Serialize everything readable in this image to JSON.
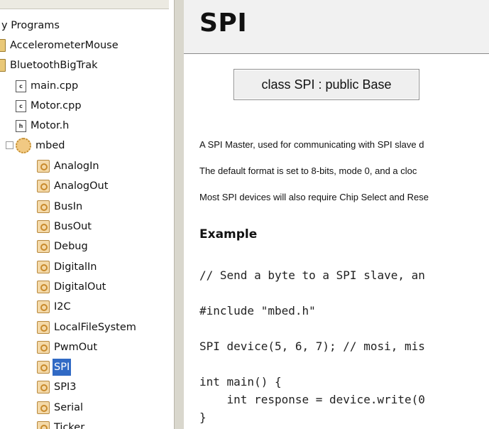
{
  "tree": {
    "items": [
      {
        "label": "y Programs",
        "icon": "none"
      },
      {
        "label": "AccelerometerMouse",
        "icon": "folder"
      },
      {
        "label": "BluetoothBigTrak",
        "icon": "folder"
      },
      {
        "label": "main.cpp",
        "icon": "cpp-file",
        "badge": "c"
      },
      {
        "label": "Motor.cpp",
        "icon": "cpp-file",
        "badge": "c"
      },
      {
        "label": "Motor.h",
        "icon": "header-file",
        "badge": "h"
      },
      {
        "label": "mbed",
        "icon": "gear"
      },
      {
        "label": "AnalogIn",
        "icon": "library"
      },
      {
        "label": "AnalogOut",
        "icon": "library"
      },
      {
        "label": "BusIn",
        "icon": "library"
      },
      {
        "label": "BusOut",
        "icon": "library"
      },
      {
        "label": "Debug",
        "icon": "library"
      },
      {
        "label": "DigitalIn",
        "icon": "library"
      },
      {
        "label": "DigitalOut",
        "icon": "library"
      },
      {
        "label": "I2C",
        "icon": "library"
      },
      {
        "label": "LocalFileSystem",
        "icon": "library"
      },
      {
        "label": "PwmOut",
        "icon": "library"
      },
      {
        "label": "SPI",
        "icon": "library",
        "selected": true
      },
      {
        "label": "SPI3",
        "icon": "library"
      },
      {
        "label": "Serial",
        "icon": "library"
      },
      {
        "label": "Ticker",
        "icon": "library"
      }
    ],
    "selection_color": "#316ac5"
  },
  "doc": {
    "title": "SPI",
    "class_box": "class SPI : public Base",
    "paragraphs": [
      "A SPI Master, used for communicating with SPI slave d",
      "The default format is set to 8-bits, mode 0, and a cloc",
      "Most SPI devices will also require Chip Select and Rese"
    ],
    "example_heading": "Example",
    "code": {
      "line1": "// Send a byte to a SPI slave, an",
      "line2": "#include \"mbed.h\"",
      "line3": "SPI device(5, 6, 7); // mosi, mis",
      "line4": "int main() {",
      "line5": "    int response = device.write(0",
      "line6": "}"
    }
  }
}
